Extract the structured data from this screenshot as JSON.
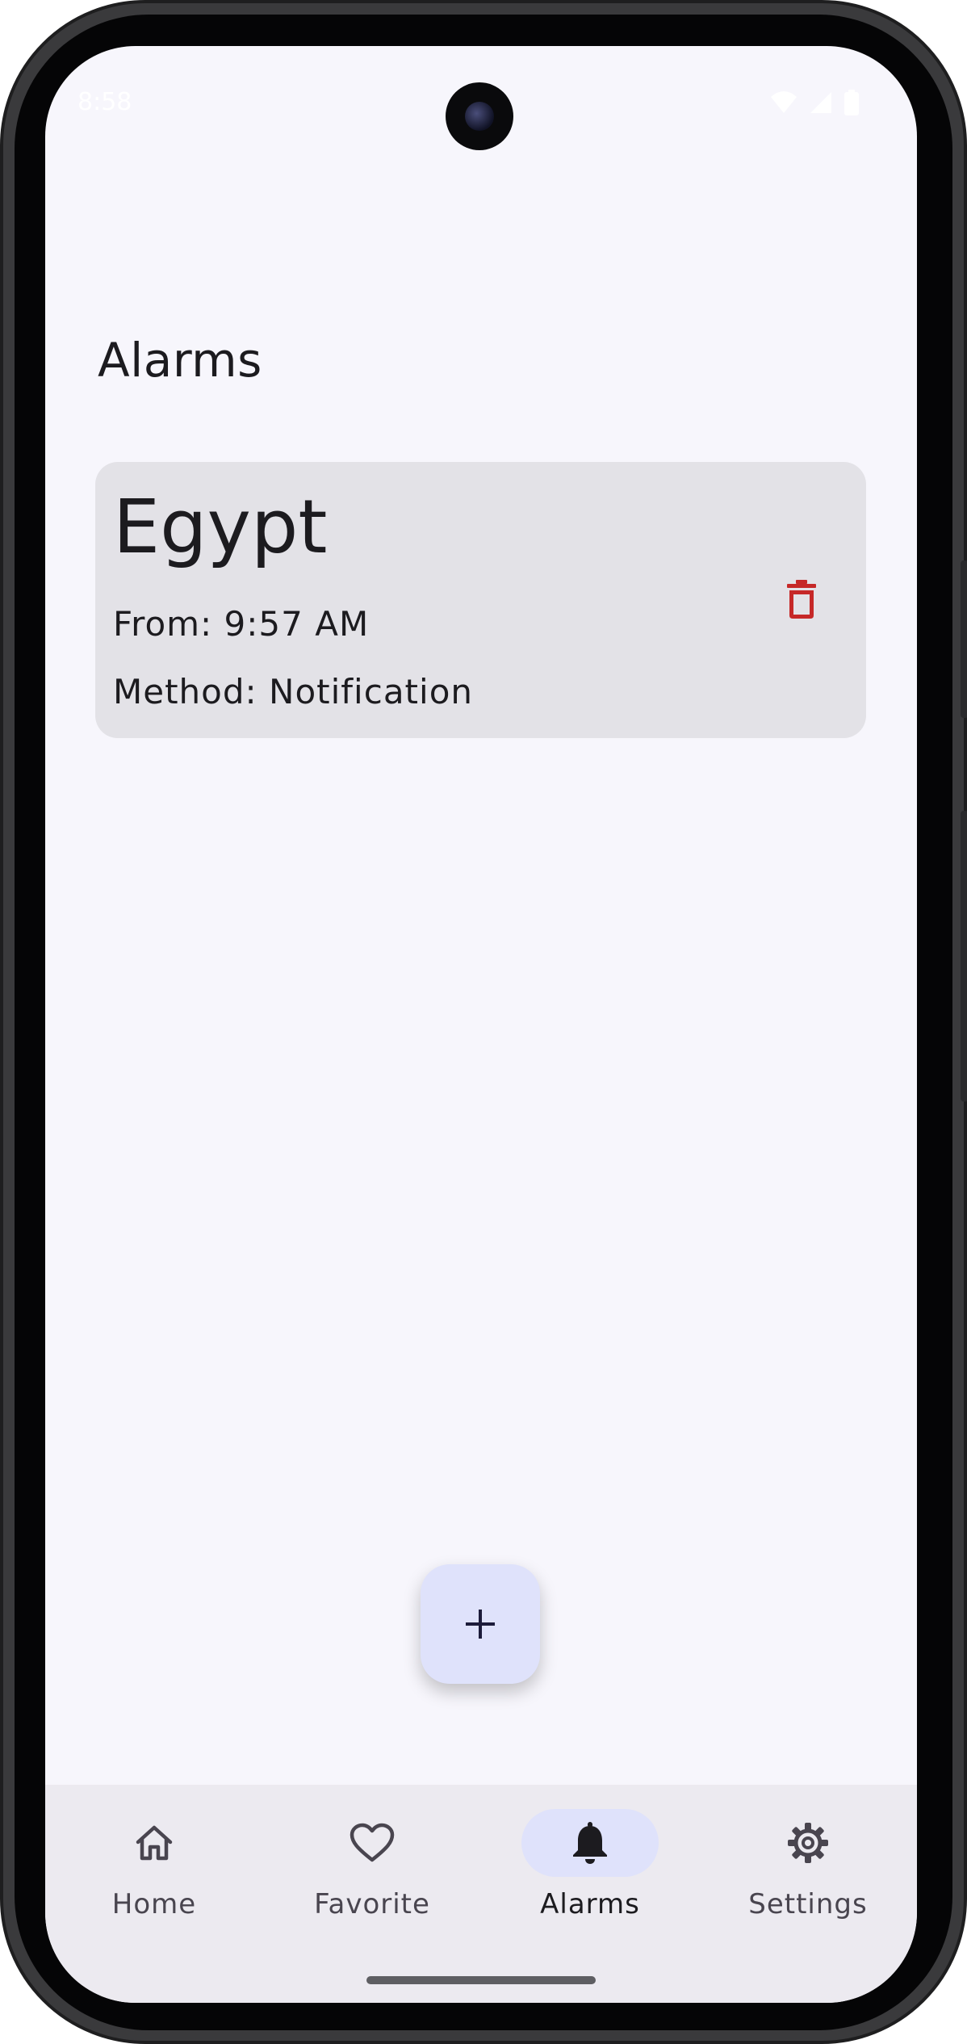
{
  "status_bar": {
    "time": "8:58",
    "icons": [
      "wifi-icon",
      "signal-icon",
      "battery-icon"
    ]
  },
  "page": {
    "title": "Alarms"
  },
  "alarms": [
    {
      "city": "Egypt",
      "from": "From: 9:57 AM",
      "method": "Method: Notification",
      "delete_icon": "trash-icon"
    }
  ],
  "fab": {
    "icon": "plus-icon"
  },
  "bottom_nav": {
    "items": [
      {
        "label": "Home",
        "icon": "home-icon",
        "active": false
      },
      {
        "label": "Favorite",
        "icon": "heart-icon",
        "active": false
      },
      {
        "label": "Alarms",
        "icon": "bell-icon",
        "active": true
      },
      {
        "label": "Settings",
        "icon": "gear-icon",
        "active": false
      }
    ]
  },
  "colors": {
    "background": "#f7f6fc",
    "card": "#e3e2e7",
    "accent_container": "#dfe2fb",
    "delete": "#c62828",
    "text": "#1c1b1f"
  }
}
